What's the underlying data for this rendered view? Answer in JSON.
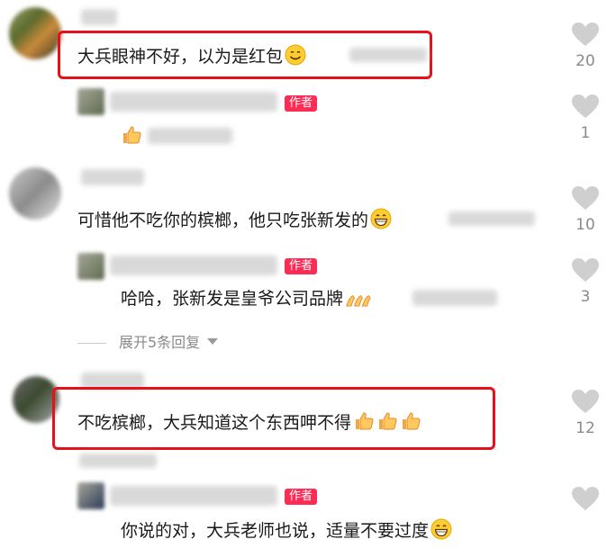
{
  "badge_label": "作者",
  "comments": [
    {
      "text": "大兵眼神不好，以为是红包",
      "likes": "20",
      "reply": {
        "text": "",
        "likes": "1"
      }
    },
    {
      "text": "可惜他不吃你的槟榔，他只吃张新发的",
      "likes": "10",
      "reply": {
        "text": "哈哈，张新发是皇爷公司品牌",
        "likes": "3"
      }
    },
    {
      "text": "不吃槟榔，大兵知道这个东西呷不得",
      "likes": "12",
      "reply": {
        "text": "你说的对，大兵老师也说，适量不要过度",
        "likes": ""
      }
    }
  ],
  "expand_label": "展开5条回复",
  "colors": {
    "badge": "#fe2c55",
    "highlight": "#e8101a",
    "like_icon": "#cfcfcf",
    "meta_gray": "#8a8a8a"
  },
  "icons": [
    "heart-icon",
    "chevron-down-icon",
    "thumbs-up-emoji",
    "smile-emoji",
    "grin-emoji",
    "clap-emoji"
  ]
}
